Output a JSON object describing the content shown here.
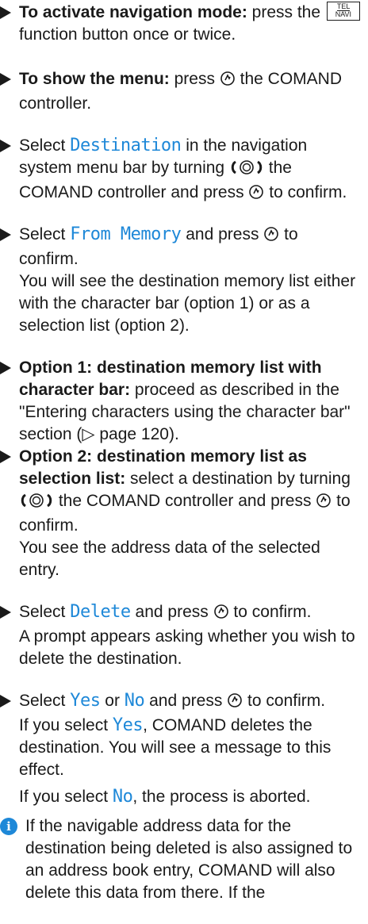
{
  "steps": [
    {
      "bold": "To activate navigation mode:",
      "text1": " press the ",
      "key_top": "TEL",
      "key_bottom": "NAVI",
      "text2": " function button once or twice."
    },
    {
      "bold": "To show the menu:",
      "text1": " press ",
      "text2": " the COMAND controller."
    },
    {
      "text1": "Select ",
      "kw": "Destination",
      "text2": " in the navigation system menu bar by turning ",
      "text3": " the COMAND controller and press ",
      "text4": " to confirm."
    },
    {
      "text1": "Select ",
      "kw": "From Memory",
      "text2": " and press ",
      "text3": " to confirm.",
      "note": "You will see the destination memory list either with the character bar (option 1) or as a selection list (option 2)."
    },
    {
      "bold": "Option 1: destination memory list with character bar:",
      "text1": " proceed as described in the \"Entering characters using the character bar\" section (",
      "ref": "▷ page 120",
      "text2": ")."
    },
    {
      "bold": "Option 2: destination memory list as selection list:",
      "text1": " select a destination by turning ",
      "text2": " the COMAND controller and press ",
      "text3": " to confirm.",
      "note": "You see the address data of the selected entry."
    },
    {
      "text1": "Select ",
      "kw": "Delete",
      "text2": " and press ",
      "text3": " to confirm.",
      "note": "A prompt appears asking whether you wish to delete the destination."
    },
    {
      "text1": "Select ",
      "kw1": "Yes",
      "text2": " or ",
      "kw2": "No",
      "text3": " and press ",
      "text4": " to confirm.",
      "line2a": "If you select ",
      "line2kw": "Yes",
      "line2b": ", COMAND deletes the destination. You will see a message to this effect.",
      "line3a": "If you select ",
      "line3kw": "No",
      "line3b": ", the process is aborted."
    }
  ],
  "info": {
    "icon": "i",
    "text": "If the navigable address data for the destination being deleted is also assigned to an address book entry, COMAND will also delete this data from there. If the"
  }
}
